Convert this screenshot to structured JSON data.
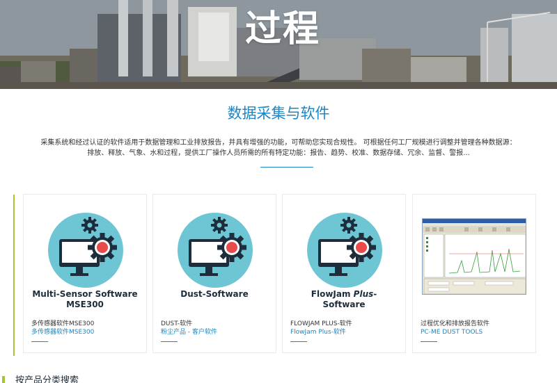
{
  "hero": {
    "title": "过程"
  },
  "section": {
    "title": "数据采集与软件",
    "intro_line1": "采集系统和经过认证的软件适用于数据管理和工业排放报告，并具有增强的功能，可帮助您实现合规性。 可根据任何工厂规模进行调整并管理各种数据源：",
    "intro_line2": "排放、释放、气象、水和过程，提供工厂操作人员所需的所有特定功能：报告、趋势、校准、数据存储、冗余、监督、警报..."
  },
  "colors": {
    "accent_blue": "#1a86c5",
    "accent_green": "#a6c532",
    "icon_circle": "#6ec6d4",
    "icon_dark": "#1e2d3b",
    "icon_red": "#e94b4b"
  },
  "cards": [
    {
      "icon": "monitor-gear-icon",
      "heading_line1": "Multi-Sensor Software",
      "heading_line2": "MSE300",
      "line1": "多传感器软件MSE300",
      "line2": "多传感器软件MSE300"
    },
    {
      "icon": "monitor-gear-icon",
      "heading_line1": "Dust-Software",
      "line1": "DUST-软件",
      "line2": "粉尘产品 - 客户软件"
    },
    {
      "icon": "monitor-gear-icon",
      "heading_line1a": "FlowJam ",
      "heading_line1b": "Plus",
      "heading_line1c": "-",
      "heading_line2": "Software",
      "line1": "FLOWJAM PLUS-软件",
      "line2": "FlowJam Plus-软件"
    },
    {
      "icon": "software-screenshot",
      "line1": "过程优化和排放报告软件",
      "line2": "PC-ME DUST TOOLS"
    }
  ],
  "bottom": {
    "title": "按产品分类搜索"
  }
}
